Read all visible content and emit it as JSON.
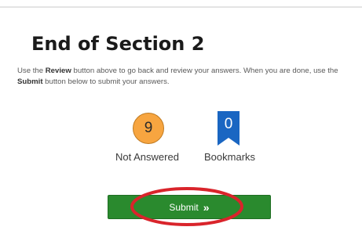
{
  "section": {
    "title": "End of Section 2",
    "instructions": {
      "part1": "Use the ",
      "review_word": "Review",
      "part2": " button above to go back and review your answers. When you are done, use the ",
      "submit_word": "Submit",
      "part3": " button below to submit your answers."
    }
  },
  "stats": {
    "not_answered": {
      "count": "9",
      "label": "Not Answered",
      "color": "#f7a540"
    },
    "bookmarks": {
      "count": "0",
      "label": "Bookmarks",
      "color": "#1a66c2"
    }
  },
  "actions": {
    "submit_label": "Submit",
    "submit_icon": "double-chevron-right-icon",
    "submit_color": "#2a8a2e"
  },
  "annotation": {
    "ring_color": "#d9242b"
  }
}
